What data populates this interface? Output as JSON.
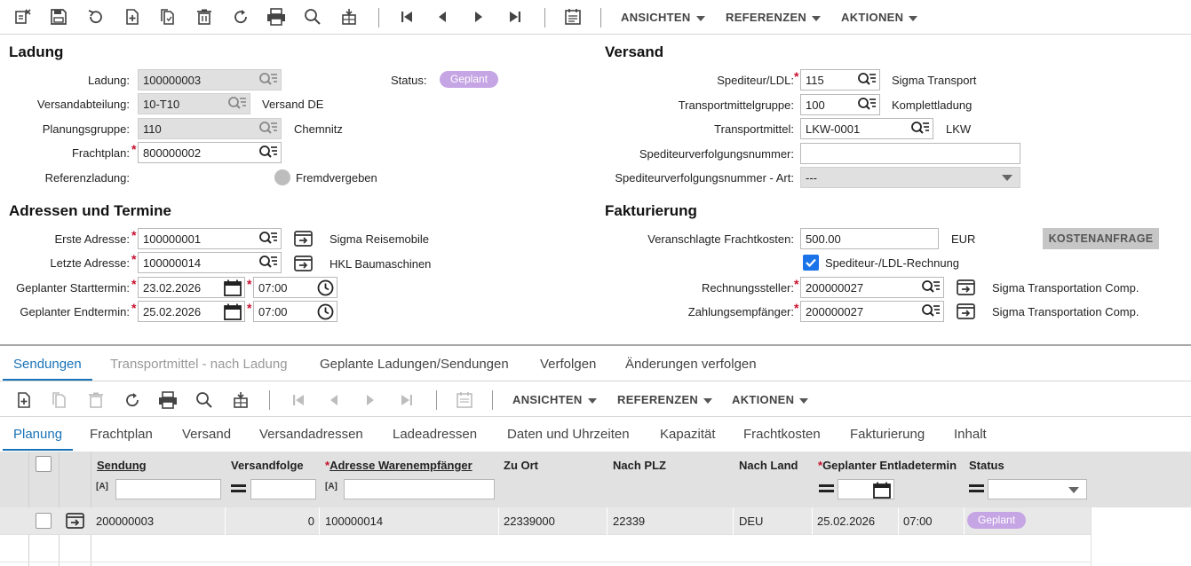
{
  "toolbar": {
    "menus": [
      "ANSICHTEN",
      "REFERENZEN",
      "AKTIONEN"
    ]
  },
  "ladung": {
    "title": "Ladung",
    "ladung_label": "Ladung:",
    "ladung_value": "100000003",
    "status_label": "Status:",
    "status_value": "Geplant",
    "versandabteilung_label": "Versandabteilung:",
    "versandabteilung_value": "10-T10",
    "versandabteilung_desc": "Versand DE",
    "planungsgruppe_label": "Planungsgruppe:",
    "planungsgruppe_value": "110",
    "planungsgruppe_desc": "Chemnitz",
    "frachtplan_label": "Frachtplan:",
    "frachtplan_value": "800000002",
    "referenzladung_label": "Referenzladung:",
    "fremdvergeben_label": "Fremdvergeben"
  },
  "versand": {
    "title": "Versand",
    "spediteur_label": "Spediteur/LDL:",
    "spediteur_value": "115",
    "spediteur_desc": "Sigma Transport",
    "tmg_label": "Transportmittelgruppe:",
    "tmg_value": "100",
    "tmg_desc": "Komplettladung",
    "tm_label": "Transportmittel:",
    "tm_value": "LKW-0001",
    "tm_desc": "LKW",
    "svn_label": "Spediteurverfolgungsnummer:",
    "svn_value": "",
    "svn_art_label": "Spediteurverfolgungsnummer - Art:",
    "svn_art_value": "---"
  },
  "adressen": {
    "title": "Adressen und Termine",
    "erste_label": "Erste Adresse:",
    "erste_value": "100000001",
    "erste_desc": "Sigma Reisemobile",
    "letzte_label": "Letzte Adresse:",
    "letzte_value": "100000014",
    "letzte_desc": "HKL Baumaschinen",
    "start_label": "Geplanter Starttermin:",
    "start_date": "23.02.2026",
    "start_time": "07:00",
    "end_label": "Geplanter Endtermin:",
    "end_date": "25.02.2026",
    "end_time": "07:00"
  },
  "fakturierung": {
    "title": "Fakturierung",
    "fracht_label": "Veranschlagte Frachtkosten:",
    "fracht_value": "500.00",
    "currency": "EUR",
    "kosten_button": "KOSTENANFRAGE",
    "rechnung_label": "Spediteur-/LDL-Rechnung",
    "rs_label": "Rechnungssteller:",
    "rs_value": "200000027",
    "rs_desc": "Sigma Transportation Comp.",
    "ze_label": "Zahlungsempfänger:",
    "ze_value": "200000027",
    "ze_desc": "Sigma Transportation Comp."
  },
  "tabs": [
    "Sendungen",
    "Transportmittel - nach Ladung",
    "Geplante Ladungen/Sendungen",
    "Verfolgen",
    "Änderungen verfolgen"
  ],
  "subtabs": [
    "Planung",
    "Frachtplan",
    "Versand",
    "Versandadressen",
    "Ladeadressen",
    "Daten und Uhrzeiten",
    "Kapazität",
    "Frachtkosten",
    "Fakturierung",
    "Inhalt"
  ],
  "grid": {
    "headers": {
      "sendung": "Sendung",
      "versandfolge": "Versandfolge",
      "adresse": "Adresse Warenempfänger",
      "zu_ort": "Zu Ort",
      "nach_plz": "Nach PLZ",
      "nach_land": "Nach Land",
      "entladetermin": "Geplanter Entladetermin",
      "status": "Status"
    },
    "row": {
      "sendung": "200000003",
      "versandfolge": "0",
      "adresse": "100000014",
      "zu_ort": "22339000",
      "nach_plz": "22339",
      "nach_land": "DEU",
      "datum": "25.02.2026",
      "zeit": "07:00",
      "status": "Geplant"
    }
  },
  "colors": {
    "accent": "#1a73b8",
    "required": "#c8102e",
    "badge": "#c6a5e4",
    "checkbox": "#1a73e8"
  }
}
